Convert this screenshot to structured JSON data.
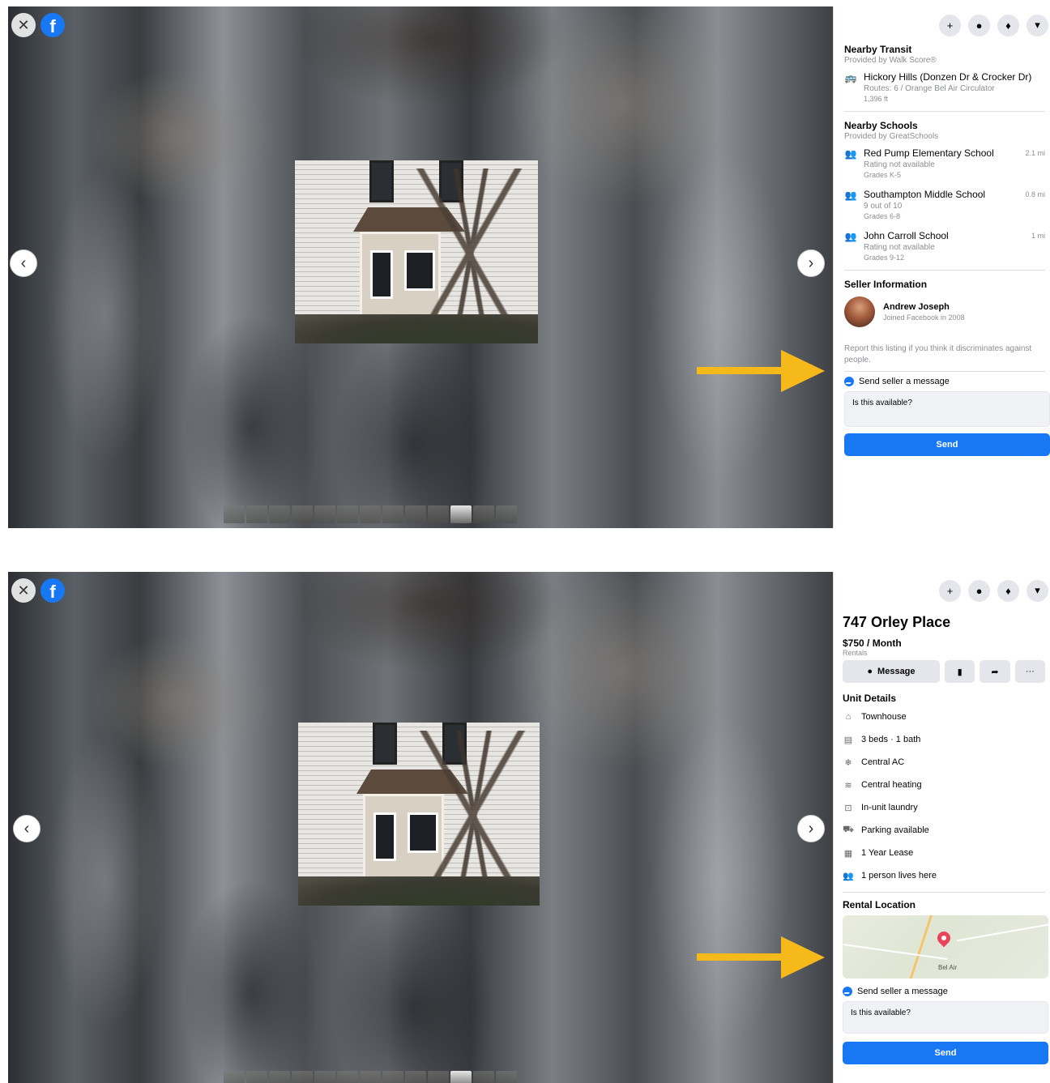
{
  "panels": [
    {
      "sidebar": {
        "header_buttons": [
          "+",
          "●",
          "♦",
          "▾"
        ],
        "transit": {
          "title": "Nearby Transit",
          "provider": "Provided by Walk Score®",
          "stops": [
            {
              "name": "Hickory Hills (Donzen Dr & Crocker Dr)",
              "routes": "Routes: 6 / Orange Bel Air Circulator",
              "distance": "1,396 ft"
            }
          ]
        },
        "schools": {
          "title": "Nearby Schools",
          "provider": "Provided by GreatSchools",
          "items": [
            {
              "name": "Red Pump Elementary School",
              "rating": "Rating not available",
              "grades": "Grades K-5",
              "distance": "2.1 mi"
            },
            {
              "name": "Southampton Middle School",
              "rating": "9 out of 10",
              "grades": "Grades 6-8",
              "distance": "0.8 mi"
            },
            {
              "name": "John Carroll School",
              "rating": "Rating not available",
              "grades": "Grades 9-12",
              "distance": "1 mi"
            }
          ]
        },
        "seller": {
          "title": "Seller Information",
          "name": "Andrew Joseph",
          "joined": "Joined Facebook in 2008"
        },
        "report_text": "Report this listing if you think it discriminates against people.",
        "send_message_label": "Send seller a message",
        "message_value": "Is this available?",
        "send_button": "Send"
      }
    },
    {
      "sidebar": {
        "header_buttons": [
          "+",
          "●",
          "♦",
          "▾"
        ],
        "listing_title": "747 Orley Place",
        "price": "$750 / Month",
        "category": "Rentals",
        "message_button": "Message",
        "unit_details_title": "Unit Details",
        "details": [
          {
            "icon": "house-icon",
            "text": "Townhouse"
          },
          {
            "icon": "bed-icon",
            "text": "3 beds · 1 bath"
          },
          {
            "icon": "snowflake-icon",
            "text": "Central AC"
          },
          {
            "icon": "heat-icon",
            "text": "Central heating"
          },
          {
            "icon": "laundry-icon",
            "text": "In-unit laundry"
          },
          {
            "icon": "car-icon",
            "text": "Parking available"
          },
          {
            "icon": "calendar-icon",
            "text": "1 Year Lease"
          },
          {
            "icon": "people-icon",
            "text": "1 person lives here"
          }
        ],
        "rental_location_title": "Rental Location",
        "map_label": "Bel Air",
        "send_message_label": "Send seller a message",
        "message_value": "Is this available?",
        "send_button": "Send"
      }
    }
  ],
  "colors": {
    "brand_blue": "#1877f2",
    "arrow_yellow": "#f6b91a",
    "map_pin": "#e9445a"
  }
}
